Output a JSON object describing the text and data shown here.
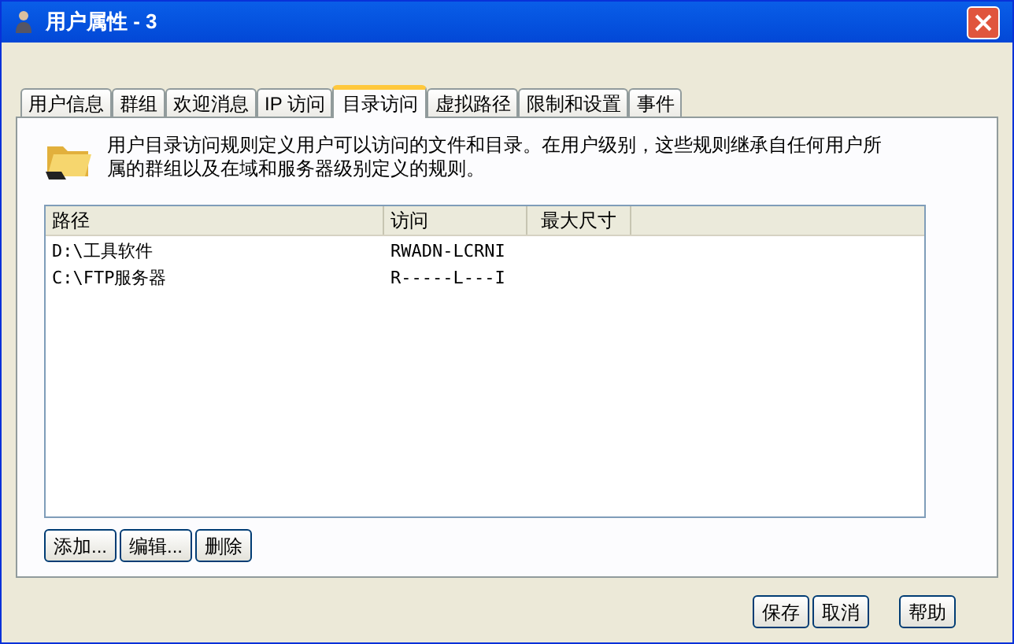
{
  "window": {
    "title": "用户属性 - 3"
  },
  "tabs": [
    {
      "label": "用户信息",
      "selected": false
    },
    {
      "label": "群组",
      "selected": false
    },
    {
      "label": "欢迎消息",
      "selected": false
    },
    {
      "label": "IP 访问",
      "selected": false
    },
    {
      "label": "目录访问",
      "selected": true
    },
    {
      "label": "虚拟路径",
      "selected": false
    },
    {
      "label": "限制和设置",
      "selected": false
    },
    {
      "label": "事件",
      "selected": false
    }
  ],
  "description": "用户目录访问规则定义用户可以访问的文件和目录。在用户级别，这些规则继承自任何用户所属的群组以及在域和服务器级别定义的规则。",
  "table": {
    "columns": [
      "路径",
      "访问",
      "最大尺寸"
    ],
    "rows": [
      {
        "path": "D:\\工具软件",
        "access": "RWADN-LCRNI"
      },
      {
        "path": "C:\\FTP服务器",
        "access": "R-----L---I"
      }
    ]
  },
  "list_buttons": [
    "添加...",
    "编辑...",
    "删除"
  ],
  "dialog_buttons": [
    "保存",
    "取消",
    "帮助"
  ]
}
